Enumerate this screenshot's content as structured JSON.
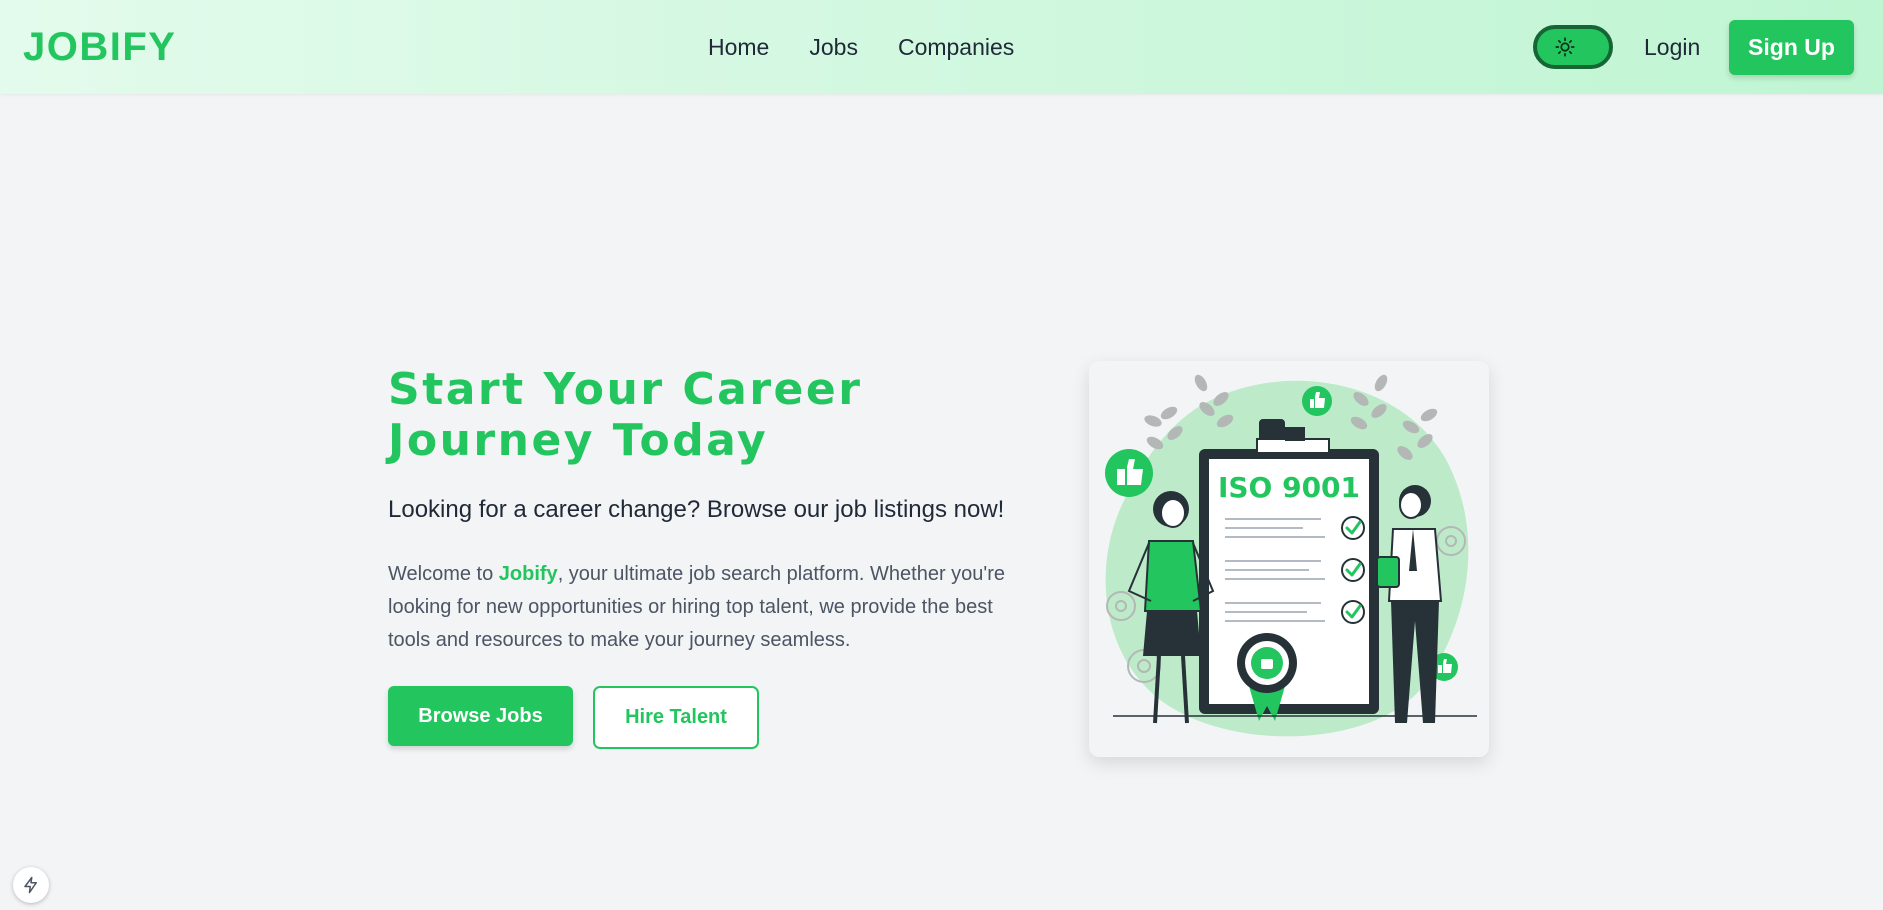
{
  "brand": {
    "logo_text": "JOBIFY",
    "accent_color": "#22c55e"
  },
  "nav": {
    "links": [
      {
        "label": "Home"
      },
      {
        "label": "Jobs"
      },
      {
        "label": "Companies"
      }
    ],
    "theme_toggle_icon": "sun-icon",
    "login_label": "Login",
    "signup_label": "Sign Up"
  },
  "hero": {
    "title_line1": "Start Your Career",
    "title_line2": "Journey Today",
    "subtitle": "Looking for a career change? Browse our job listings now!",
    "desc_prefix": "Welcome to ",
    "desc_brand": "Jobify",
    "desc_suffix": ", your ultimate job search platform. Whether you're looking for new opportunities or hiring top talent, we provide the best tools and resources to make your journey seamless.",
    "primary_button": "Browse Jobs",
    "secondary_button": "Hire Talent"
  },
  "illustration": {
    "clipboard_heading": "ISO 9001",
    "icons": [
      "thumbs-up-icon",
      "check-icon",
      "award-badge-icon",
      "gear-icon",
      "leaf-icon"
    ]
  },
  "dev_indicator": {
    "icon": "lightning-icon"
  }
}
